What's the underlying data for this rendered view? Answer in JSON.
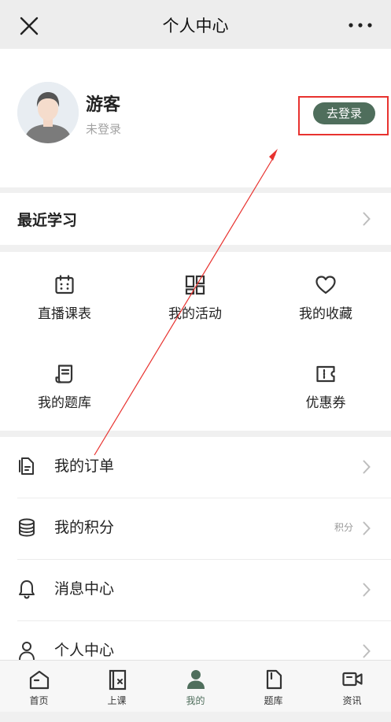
{
  "nav": {
    "title": "个人中心",
    "close_icon": "close-icon",
    "more_icon": "more-icon"
  },
  "profile": {
    "name": "游客",
    "status": "未登录",
    "login_label": "去登录"
  },
  "recent": {
    "label": "最近学习"
  },
  "grid": {
    "items": [
      {
        "label": "直播课表",
        "icon": "calendar-icon"
      },
      {
        "label": "我的活动",
        "icon": "grid-icon"
      },
      {
        "label": "我的收藏",
        "icon": "heart-icon"
      },
      {
        "label": "我的题库",
        "icon": "scroll-icon"
      },
      {
        "label": "优惠券",
        "icon": "coupon-icon"
      }
    ]
  },
  "list": {
    "items": [
      {
        "label": "我的订单",
        "icon": "order-icon"
      },
      {
        "label": "我的积分",
        "icon": "coins-icon",
        "extra": "积分"
      },
      {
        "label": "消息中心",
        "icon": "bell-icon"
      },
      {
        "label": "个人中心",
        "icon": "user-icon"
      }
    ]
  },
  "tabs": [
    {
      "label": "首页",
      "icon": "home-icon"
    },
    {
      "label": "上课",
      "icon": "class-icon"
    },
    {
      "label": "我的",
      "icon": "person-icon",
      "active": true
    },
    {
      "label": "题库",
      "icon": "question-bank-icon"
    },
    {
      "label": "资讯",
      "icon": "video-icon"
    }
  ],
  "colors": {
    "accent": "#4f6e5c",
    "annotation": "#e8322f"
  }
}
